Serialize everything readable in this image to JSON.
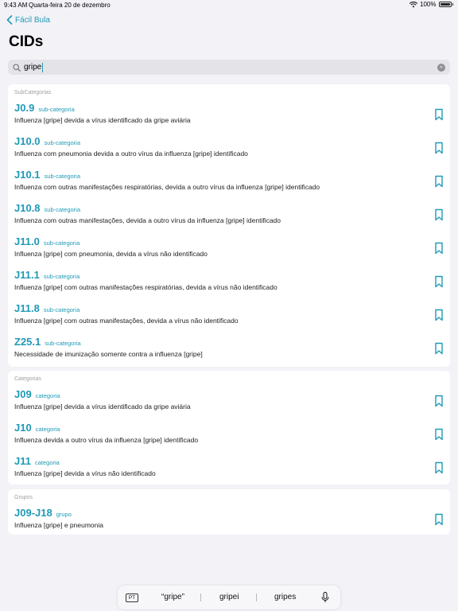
{
  "status_bar": {
    "time": "9:43 AM",
    "date": "Quarta-feira 20 de dezembro",
    "battery": "100%"
  },
  "nav": {
    "back_label": "Fácil Bula"
  },
  "page_title": "CIDs",
  "search": {
    "value": "gripe",
    "placeholder": ""
  },
  "sections": {
    "subcategorias": {
      "header": "SubCategorias",
      "items": [
        {
          "code": "J0.9",
          "kind": "sub-categoria",
          "desc": "Influenza [gripe] devida a vírus identificado da gripe aviária"
        },
        {
          "code": "J10.0",
          "kind": "sub-categoria",
          "desc": "Influenza com pneumonia devida a outro vírus da influenza [gripe] identificado"
        },
        {
          "code": "J10.1",
          "kind": "sub-categoria",
          "desc": "Influenza com outras manifestações respiratórias, devida a outro vírus da influenza [gripe] identificado"
        },
        {
          "code": "J10.8",
          "kind": "sub-categoria",
          "desc": "Influenza com outras manifestações, devida a outro vírus da influenza [gripe] identificado"
        },
        {
          "code": "J11.0",
          "kind": "sub-categoria",
          "desc": "Influenza [gripe] com pneumonia, devida a vírus não identificado"
        },
        {
          "code": "J11.1",
          "kind": "sub-categoria",
          "desc": "Influenza [gripe] com outras manifestações respiratórias, devida a vírus não identificado"
        },
        {
          "code": "J11.8",
          "kind": "sub-categoria",
          "desc": "Influenza [gripe] com outras manifestações, devida a vírus não identificado"
        },
        {
          "code": "Z25.1",
          "kind": "sub-categoria",
          "desc": "Necessidade de imunização somente contra a influenza [gripe]"
        }
      ]
    },
    "categorias": {
      "header": "Categorias",
      "items": [
        {
          "code": "J09",
          "kind": "categoria",
          "desc": "Influenza [gripe] devida a vírus identificado da gripe aviária"
        },
        {
          "code": "J10",
          "kind": "categoria",
          "desc": "Influenza devida a outro vírus da influenza [gripe] identificado"
        },
        {
          "code": "J11",
          "kind": "categoria",
          "desc": "Influenza [gripe] devida a vírus não identificado"
        }
      ]
    },
    "grupos": {
      "header": "Grupos",
      "items": [
        {
          "code": "J09-J18",
          "kind": "grupo",
          "desc": "Influenza [gripe] e pneumonia"
        }
      ]
    }
  },
  "keyboard_bar": {
    "language_key": "PT",
    "suggestions": [
      "“gripe”",
      "gripei",
      "gripes"
    ]
  },
  "colors": {
    "accent": "#1f9ab6",
    "background": "#f2f2f7"
  },
  "icons": [
    "back-chevron-icon",
    "search-icon",
    "clear-icon",
    "bookmark-icon",
    "microphone-icon",
    "wifi-icon",
    "battery-icon"
  ]
}
